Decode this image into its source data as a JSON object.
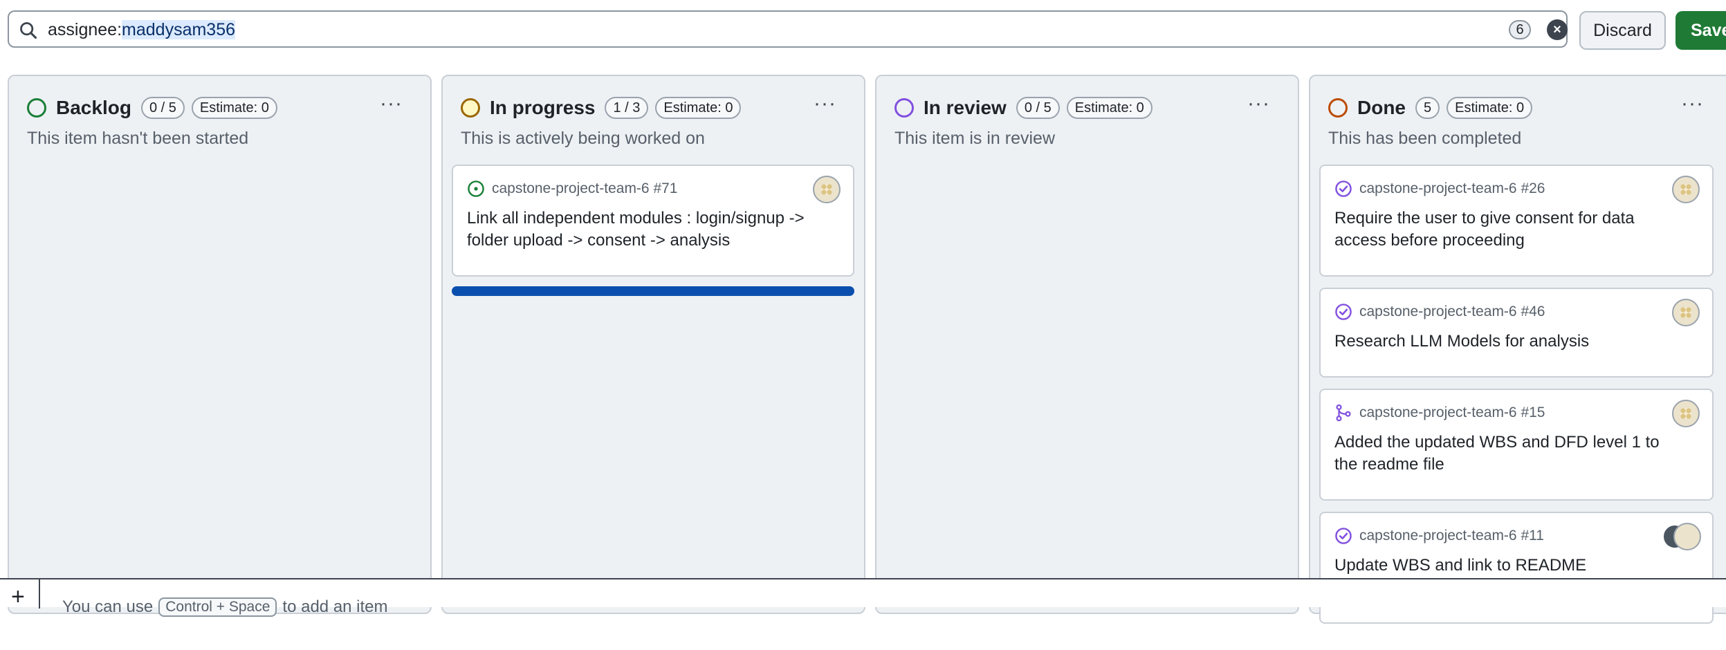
{
  "filter": {
    "query_key": "assignee:",
    "query_value": "maddysam356",
    "count": "6"
  },
  "actions": {
    "discard": "Discard",
    "save": "Save"
  },
  "columns": [
    {
      "title": "Backlog",
      "count": "0 / 5",
      "estimate": "Estimate: 0",
      "description": "This item hasn't been started",
      "color": "#1a7f37",
      "menu": "···"
    },
    {
      "title": "In progress",
      "count": "1 / 3",
      "estimate": "Estimate: 0",
      "description": "This is actively being worked on",
      "color": "#9a6700",
      "menu": "···"
    },
    {
      "title": "In review",
      "count": "0 / 5",
      "estimate": "Estimate: 0",
      "description": "This item is in review",
      "color": "#8250df",
      "menu": "···"
    },
    {
      "title": "Done",
      "count": "5",
      "estimate": "Estimate: 0",
      "description": "This has been completed",
      "color": "#bc4c00",
      "menu": "···"
    }
  ],
  "cards": {
    "in_progress": [
      {
        "repo": "capstone-project-team-6 #71",
        "title": "Link all independent modules : login/signup -> folder upload -> consent -> analysis",
        "icon": "open-issue-icon"
      }
    ],
    "done": [
      {
        "repo": "capstone-project-team-6 #26",
        "title": "Require the user to give consent for data access before proceeding",
        "icon": "closed-issue-icon"
      },
      {
        "repo": "capstone-project-team-6 #46",
        "title": "Research LLM Models for analysis",
        "icon": "closed-issue-icon"
      },
      {
        "repo": "capstone-project-team-6 #15",
        "title": "Added the updated WBS and DFD level 1 to the readme file",
        "icon": "merged-pr-icon"
      },
      {
        "repo": "capstone-project-team-6 #11",
        "title": "Update WBS and link to README",
        "icon": "closed-issue-icon"
      }
    ]
  },
  "progress": {
    "in_progress_fraction": 1.0
  },
  "add_bar": {
    "plus": "+",
    "hint_prefix": "You can use",
    "shortcut": "Control + Space",
    "hint_suffix": "to add an item"
  }
}
